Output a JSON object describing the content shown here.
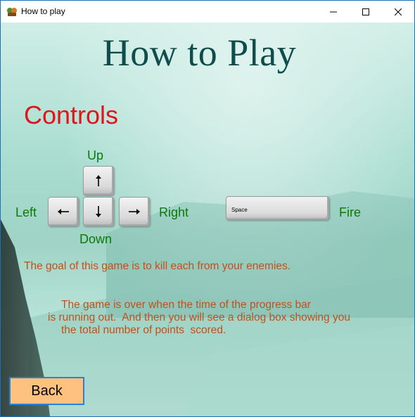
{
  "window": {
    "title": "How to play",
    "icon": "game-app-icon",
    "controls": {
      "minimize": "minimize-icon",
      "maximize": "maximize-icon",
      "close": "close-icon"
    }
  },
  "page": {
    "heading": "How to Play",
    "controls_title": "Controls",
    "arrows": {
      "up_label": "Up",
      "down_label": "Down",
      "left_label": "Left",
      "right_label": "Right"
    },
    "space_key_label": "Space",
    "fire_label": "Fire",
    "goal_text": "The goal of this game is to kill each from your enemies.",
    "gameover_lines": [
      "The game is over when the time of the progress bar",
      "is running out.  And then you will see a dialog box showing you",
      "the total number of points  scored."
    ],
    "back_label": "Back"
  },
  "colors": {
    "heading": "#0f4d4d",
    "controls_title": "#e0141a",
    "labels": "#0a7a0a",
    "body_text": "#c0511a",
    "back_button": "#ffc17e"
  }
}
